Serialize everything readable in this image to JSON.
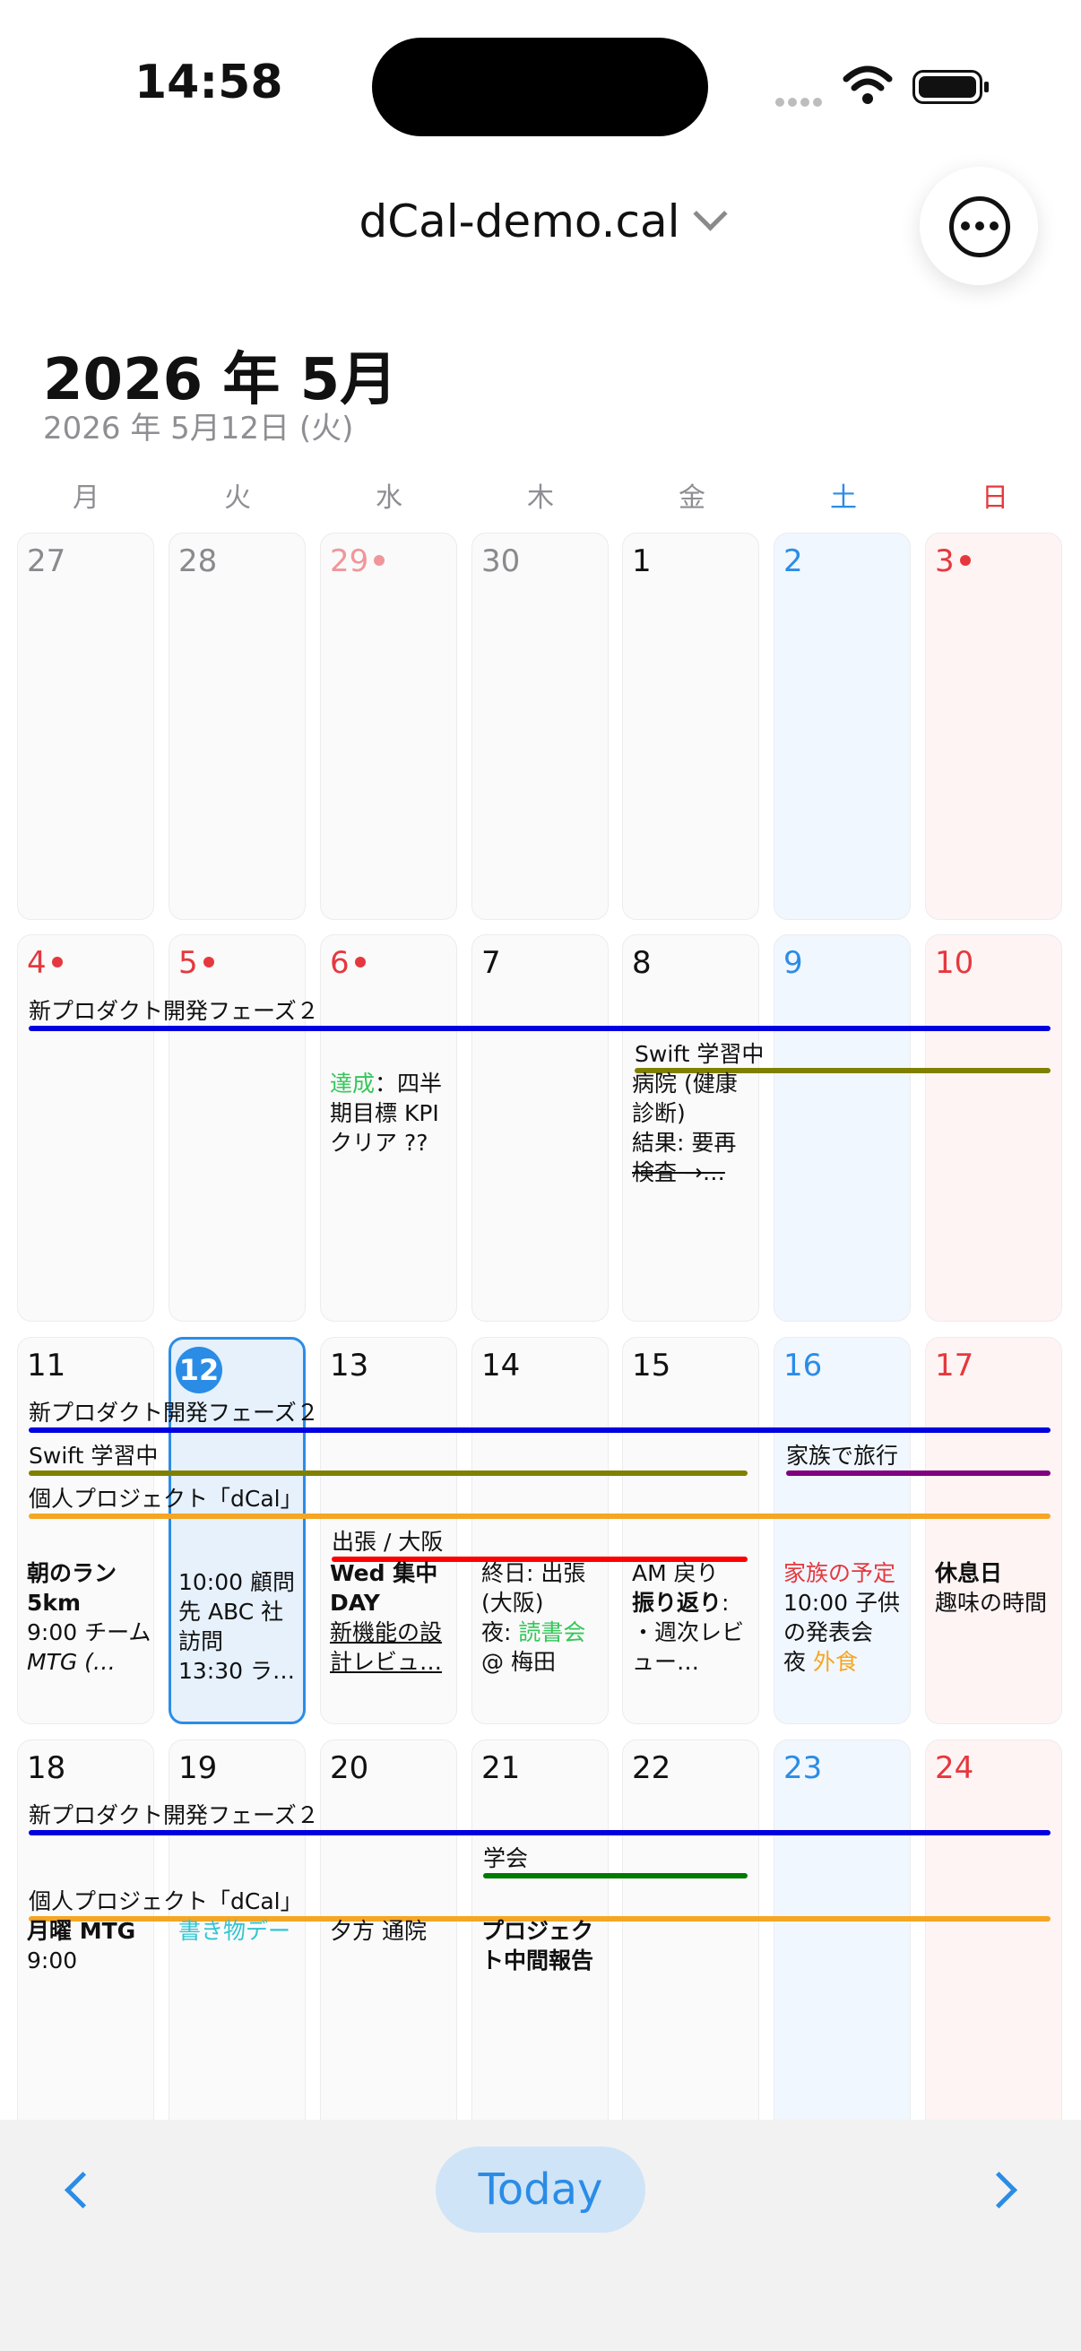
{
  "status": {
    "time": "14:58"
  },
  "header": {
    "calendar_name": "dCal-demo.cal"
  },
  "month": {
    "title": "2026 年 5月",
    "selected_date": "2026 年 5月12日 (火)"
  },
  "weekdays": [
    "月",
    "火",
    "水",
    "木",
    "金",
    "土",
    "日"
  ],
  "weeks": [
    {
      "days": [
        "27",
        "28",
        "29",
        "30",
        "1",
        "2",
        "3"
      ]
    },
    {
      "days": [
        "4",
        "5",
        "6",
        "7",
        "8",
        "9",
        "10"
      ]
    },
    {
      "days": [
        "11",
        "12",
        "13",
        "14",
        "15",
        "16",
        "17"
      ]
    },
    {
      "days": [
        "18",
        "19",
        "20",
        "21",
        "22",
        "23",
        "24"
      ]
    }
  ],
  "bars": {
    "product_phase2": "新プロダクト開発フェーズ２",
    "swift": "Swift 学習中",
    "family_trip": "家族で旅行",
    "personal_project": "個人プロジェクト「dCal」",
    "business_trip": "出張 / 大阪",
    "conference": "学会"
  },
  "events": {
    "may6": {
      "achieve": "達成",
      "rest": "：四半期目標 KPI クリア ??"
    },
    "may8": {
      "l1": "病院 (健康診断)",
      "l2": "結果: 要再",
      "l3": "検査 →…"
    },
    "may11": {
      "l1": "朝のラン 5km",
      "l2": "9:00 チーム",
      "l3": "MTG (…"
    },
    "may12": {
      "l1": "10:00 顧問先 ABC 社訪問",
      "l2": "13:30 ラ…"
    },
    "may13": {
      "l1": "Wed 集中DAY",
      "l2": "新機能の設計レビュ…"
    },
    "may14": {
      "l1": "終日: 出張 (大阪)",
      "l2a": "夜: ",
      "l2b": "読書会",
      "l3": "@ 梅田"
    },
    "may15": {
      "l1": "AM 戻り",
      "l2a": "振り返り",
      "l2b": ":",
      "l3": "・週次レビュー…"
    },
    "may16": {
      "l1": "家族の予定",
      "l2": "10:00 子供の発表会",
      "l3a": "夜 ",
      "l3b": "外食"
    },
    "may17": {
      "l1": "休息日",
      "l2": "趣味の時間"
    },
    "may18": {
      "l1": "月曜 MTG",
      "l2": "9:00"
    },
    "may19": {
      "l1": "書き物デー"
    },
    "may20": {
      "l1": "夕方 通院"
    },
    "may21": {
      "l1": "プロジェクト中間報告"
    }
  },
  "footer": {
    "today_label": "Today"
  },
  "colors": {
    "accent": "#2b8ce6",
    "holiday_red": "#e5383e",
    "saturday_blue": "#2b8ce6",
    "bar_blue": "#0000e0",
    "bar_olive": "#808000",
    "bar_orange": "#f5a623",
    "bar_purple": "#800080",
    "bar_red": "#ff0000",
    "bar_green": "#007a00"
  }
}
